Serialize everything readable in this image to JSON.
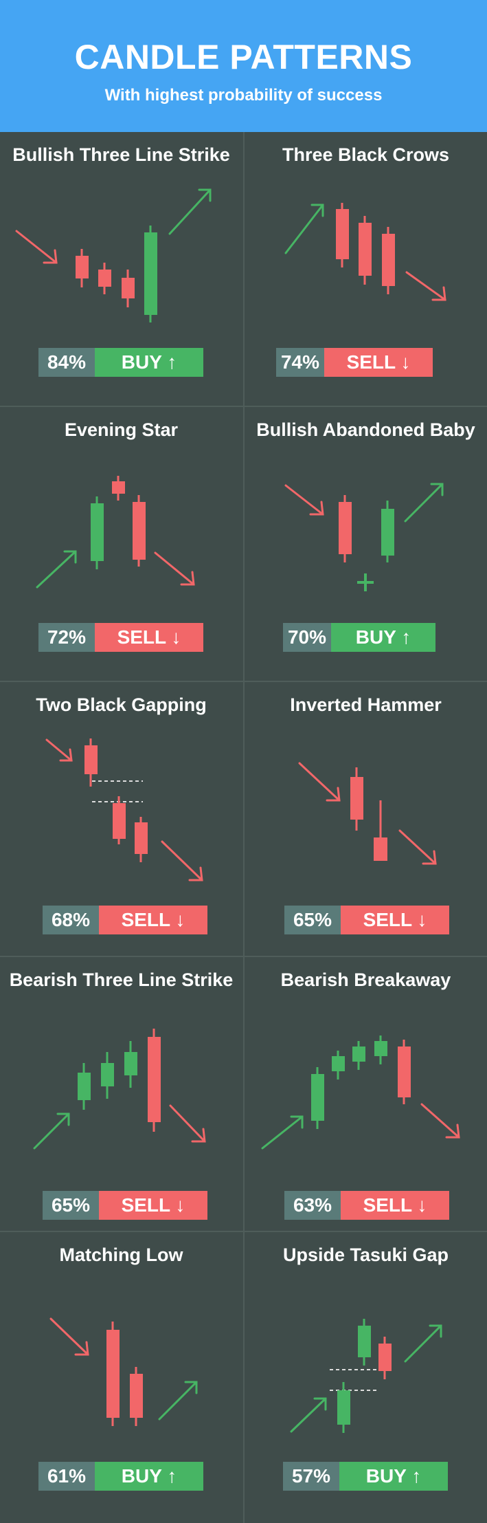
{
  "header": {
    "title": "CANDLE PATTERNS",
    "subtitle": "With highest probability of success"
  },
  "colors": {
    "bull": "#47b564",
    "bear": "#f26769",
    "header": "#45a5f3",
    "background": "#3f4c4a"
  },
  "patterns": [
    {
      "title": "Bullish Three Line Strike",
      "pct": "84%",
      "action": "BUY ↑",
      "signal": "buy"
    },
    {
      "title": "Three Black Crows",
      "pct": "74%",
      "action": "SELL ↓",
      "signal": "sell"
    },
    {
      "title": "Evening Star",
      "pct": "72%",
      "action": "SELL ↓",
      "signal": "sell"
    },
    {
      "title": "Bullish Abandoned Baby",
      "pct": "70%",
      "action": "BUY ↑",
      "signal": "buy"
    },
    {
      "title": "Two Black Gapping",
      "pct": "68%",
      "action": "SELL ↓",
      "signal": "sell"
    },
    {
      "title": "Inverted Hammer",
      "pct": "65%",
      "action": "SELL ↓",
      "signal": "sell"
    },
    {
      "title": "Bearish Three Line Strike",
      "pct": "65%",
      "action": "SELL ↓",
      "signal": "sell"
    },
    {
      "title": "Bearish Breakaway",
      "pct": "63%",
      "action": "SELL ↓",
      "signal": "sell"
    },
    {
      "title": "Matching Low",
      "pct": "61%",
      "action": "BUY ↑",
      "signal": "buy"
    },
    {
      "title": "Upside Tasuki Gap",
      "pct": "57%",
      "action": "BUY ↑",
      "signal": "buy"
    }
  ]
}
